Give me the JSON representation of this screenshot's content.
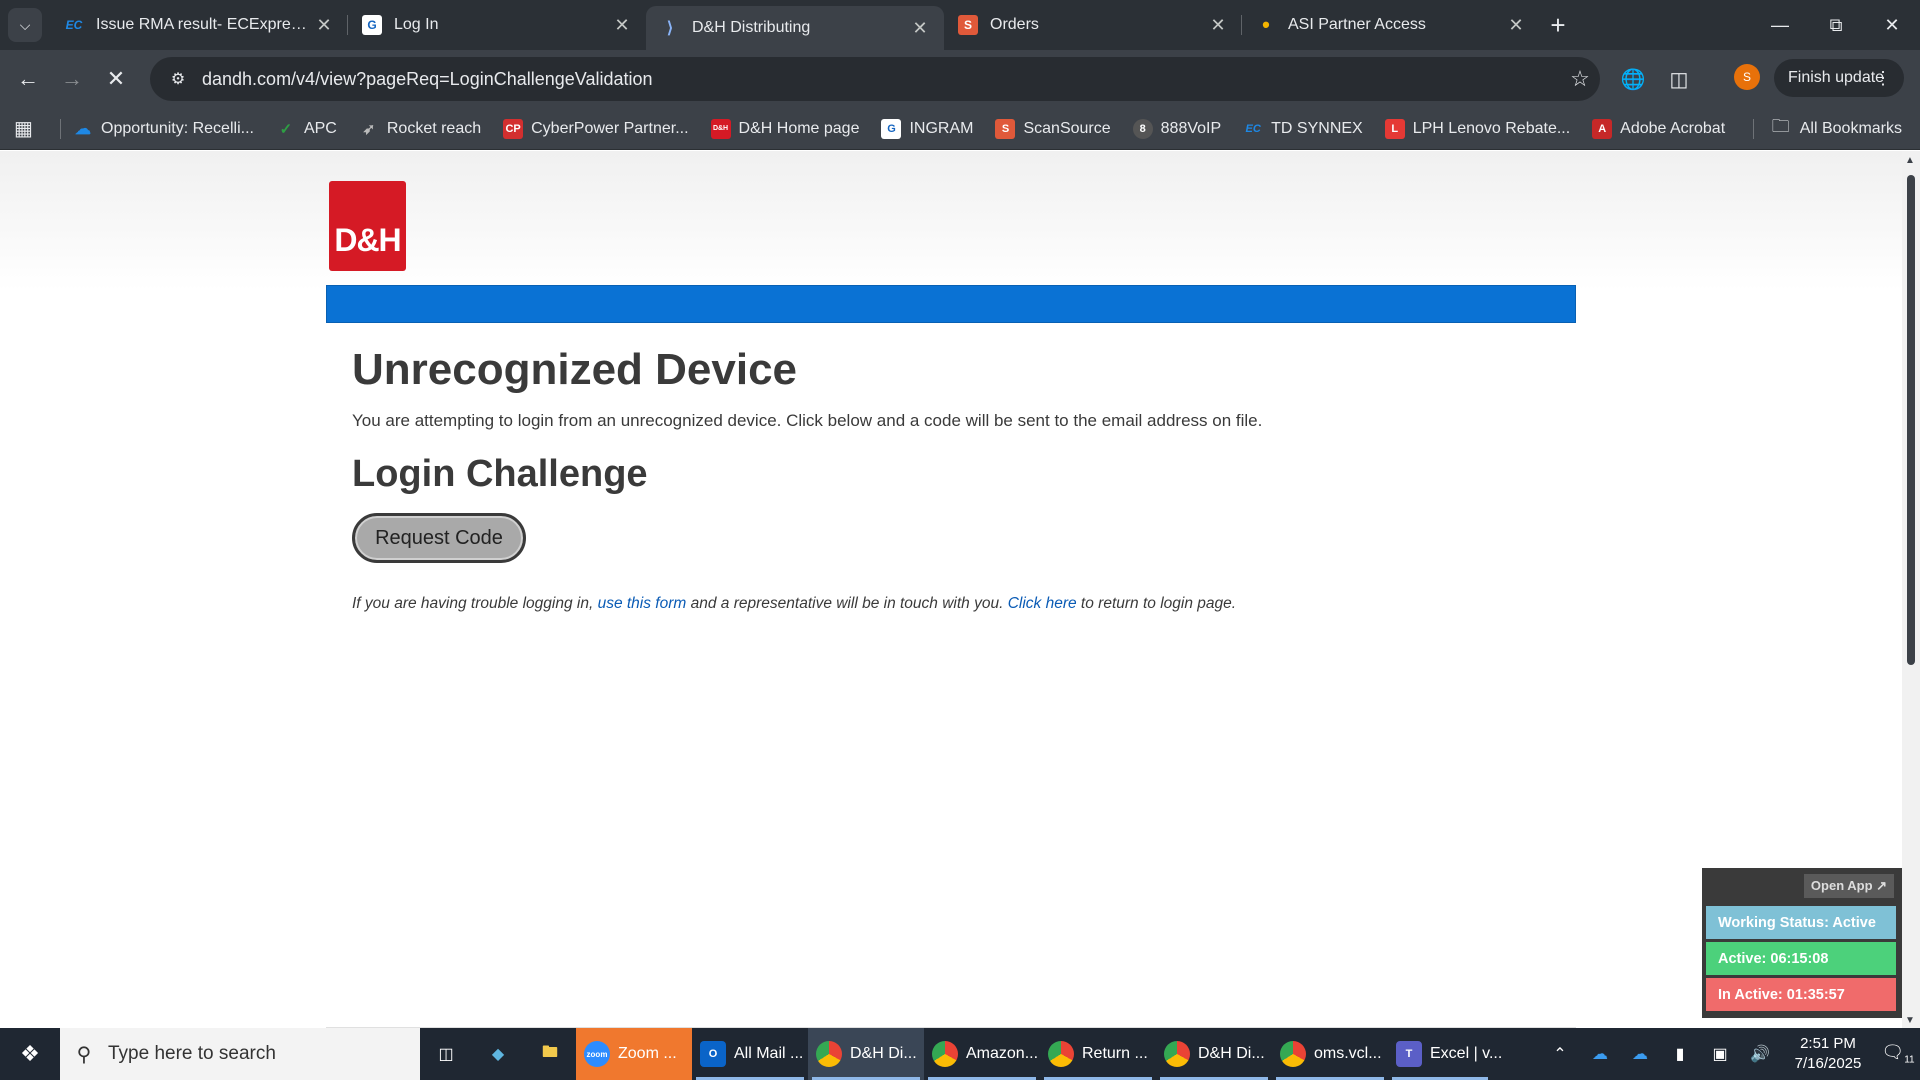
{
  "browser": {
    "tabs": [
      {
        "title": "Issue RMA result- ECExpress - T",
        "favicon": "EC",
        "favicon_color": "#1e88e5",
        "active": false
      },
      {
        "title": "Log In",
        "favicon": "G",
        "favicon_color": "#1565c0",
        "active": false
      },
      {
        "title": "D&H Distributing",
        "favicon": "⟩",
        "favicon_color": "#4a90d9",
        "active": true
      },
      {
        "title": "Orders",
        "favicon": "S",
        "favicon_color": "#e0593a",
        "active": false
      },
      {
        "title": "ASI Partner Access",
        "favicon": "•",
        "favicon_color": "#f4b400",
        "active": false
      }
    ],
    "new_tab": "+",
    "url": "dandh.com/v4/view?pageReq=LoginChallengeValidation",
    "profile_initial": "S",
    "finish_update": "Finish update",
    "bookmarks": [
      {
        "label": "Opportunity: Recelli...",
        "icon": "☁",
        "color": "#1e88e5"
      },
      {
        "label": "APC",
        "icon": "✓",
        "color": "#2e9e44"
      },
      {
        "label": "Rocket reach",
        "icon": "🚀",
        "color": "#888888"
      },
      {
        "label": "CyberPower Partner...",
        "icon": "CP",
        "color": "#d32f2f"
      },
      {
        "label": "D&H Home page",
        "icon": "D&H",
        "color": "#d51a25"
      },
      {
        "label": "INGRAM",
        "icon": "G",
        "color": "#1565c0"
      },
      {
        "label": "ScanSource",
        "icon": "S",
        "color": "#e0593a"
      },
      {
        "label": "888VoIP",
        "icon": "8",
        "color": "#555555"
      },
      {
        "label": "TD SYNNEX",
        "icon": "EC",
        "color": "#1e88e5"
      },
      {
        "label": "LPH Lenovo Rebate...",
        "icon": "L",
        "color": "#e53935"
      },
      {
        "label": "Adobe Acrobat",
        "icon": "A",
        "color": "#c62828"
      }
    ],
    "all_bookmarks": "All Bookmarks"
  },
  "page": {
    "logo_text": "D&H",
    "title": "Unrecognized Device",
    "intro": "You are attempting to login from an unrecognized device. Click below and a code will be sent to the email address on file.",
    "challenge_heading": "Login Challenge",
    "request_code_label": "Request Code",
    "help": {
      "part1": "If you are having trouble logging in, ",
      "link1": "use this form",
      "part2": " and a representative will be in touch with you. ",
      "link2": "Click here",
      "part3": " to return to login page."
    }
  },
  "widget": {
    "open_app": "Open App ↗",
    "working_status": "Working Status: Active",
    "active_time": "Active: 06:15:08",
    "inactive_time": "In Active: 01:35:57"
  },
  "taskbar": {
    "search_placeholder": "Type here to search",
    "apps": [
      {
        "label": "Zoom ...",
        "icon": "zoom",
        "color": "#2d8cff",
        "class": "zoom"
      },
      {
        "label": "All Mail ...",
        "icon": "O",
        "color": "#0a64c8",
        "class": "running"
      },
      {
        "label": "D&H Di...",
        "icon": "◉",
        "color": "#ea4335",
        "class": "running active"
      },
      {
        "label": "Amazon...",
        "icon": "◉",
        "color": "#ea4335",
        "class": "running"
      },
      {
        "label": "Return ...",
        "icon": "◉",
        "color": "#ea4335",
        "class": "running"
      },
      {
        "label": "D&H Di...",
        "icon": "◉",
        "color": "#ea4335",
        "class": "running"
      },
      {
        "label": "oms.vcl...",
        "icon": "◉",
        "color": "#ea4335",
        "class": "running"
      },
      {
        "label": "Excel | v...",
        "icon": "T",
        "color": "#5b5fc7",
        "class": "running"
      }
    ],
    "time": "2:51 PM",
    "date": "7/16/2025",
    "notification_count": "11"
  }
}
